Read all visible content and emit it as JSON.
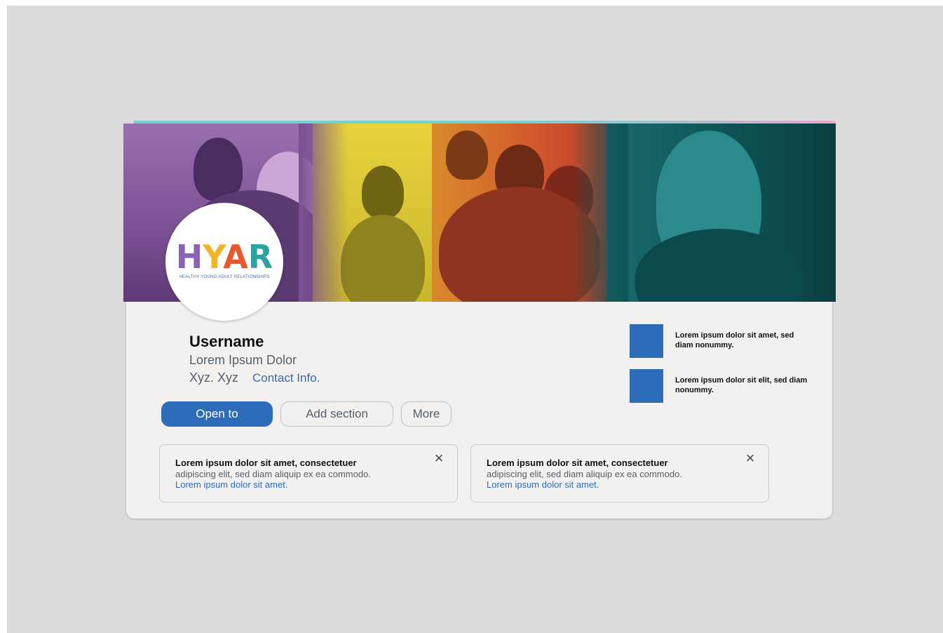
{
  "profile": {
    "username": "Username",
    "headline": "Lorem Ipsum Dolor",
    "location": "Xyz. Xyz",
    "contact_label": "Contact Info."
  },
  "logo": {
    "letters": [
      "H",
      "Y",
      "A",
      "R"
    ],
    "letter_colors": [
      "#8a63b8",
      "#f0b428",
      "#e8582c",
      "#2ba39e"
    ],
    "tagline": "HEALTHY YOUNG ADULT RELATIONSHIPS"
  },
  "actions": {
    "open_to": "Open to",
    "add_section": "Add section",
    "more": "More"
  },
  "side_items": [
    {
      "text": "Lorem ipsum dolor sit amet, sed diam nonummy."
    },
    {
      "text": "Lorem ipsum dolor sit elit, sed diam nonummy."
    }
  ],
  "notices": [
    {
      "line1": "Lorem ipsum dolor sit amet, consectetuer",
      "line2": "adipiscing elit, sed diam aliquip ex ea commodo.",
      "link": "Lorem ipsum dolor sit amet.",
      "close_icon": "close-icon"
    },
    {
      "line1": "Lorem ipsum dolor sit amet, consectetuer",
      "line2": "adipiscing elit, sed diam aliquip ex ea commodo.",
      "link": "Lorem ipsum dolor sit amet.",
      "close_icon": "close-icon"
    }
  ],
  "colors": {
    "accent": "#2d6cb8",
    "card_bg": "#f2f1ef",
    "page_bg": "#dcdcdc",
    "banner_purple": "#7a5193",
    "banner_yellow": "#e7d33b",
    "banner_orange": "#d2552c",
    "banner_teal": "#0e5557"
  }
}
